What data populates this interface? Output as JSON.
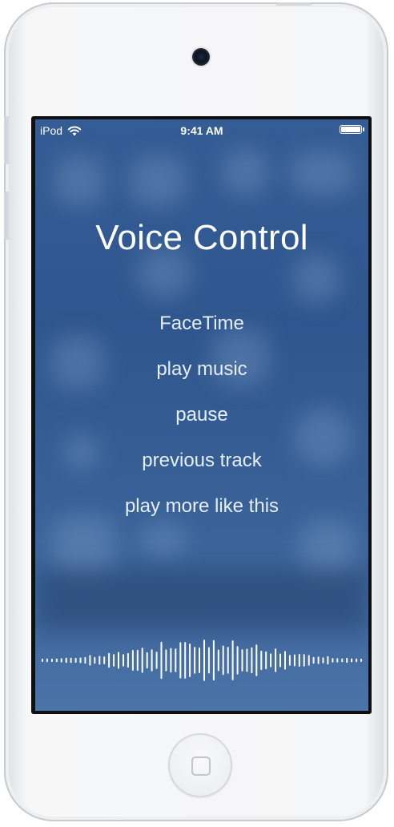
{
  "device": {
    "body_color": "#f5f6f7",
    "screen_color": "#355d95"
  },
  "status_bar": {
    "carrier": "iPod",
    "time": "9:41 AM",
    "wifi_icon": "wifi-icon",
    "battery_icon": "battery-icon"
  },
  "voice_control": {
    "title": "Voice Control",
    "commands": [
      "FaceTime",
      "play music",
      "pause",
      "previous track",
      "play more like this"
    ],
    "waveform_icon": "waveform-icon"
  }
}
